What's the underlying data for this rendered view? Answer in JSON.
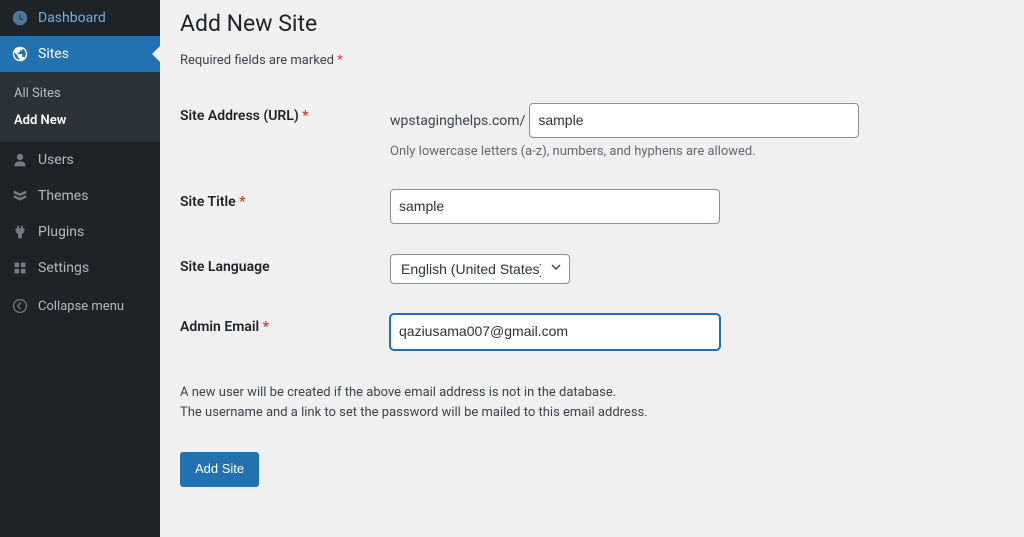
{
  "sidebar": {
    "dashboard": "Dashboard",
    "sites": "Sites",
    "sites_sub": {
      "all": "All Sites",
      "add_new": "Add New"
    },
    "users": "Users",
    "themes": "Themes",
    "plugins": "Plugins",
    "settings": "Settings",
    "collapse": "Collapse menu"
  },
  "page": {
    "title": "Add New Site",
    "required_note": "Required fields are marked ",
    "required_mark": "*"
  },
  "form": {
    "site_address": {
      "label": "Site Address (URL) ",
      "prefix": "wpstaginghelps.com/",
      "value": "sample",
      "desc": "Only lowercase letters (a-z), numbers, and hyphens are allowed."
    },
    "site_title": {
      "label": "Site Title ",
      "value": "sample"
    },
    "site_language": {
      "label": "Site Language",
      "value": "English (United States)"
    },
    "admin_email": {
      "label": "Admin Email ",
      "value": "qaziusama007@gmail.com"
    },
    "info_line1": "A new user will be created if the above email address is not in the database.",
    "info_line2": "The username and a link to set the password will be mailed to this email address.",
    "submit": "Add Site"
  }
}
